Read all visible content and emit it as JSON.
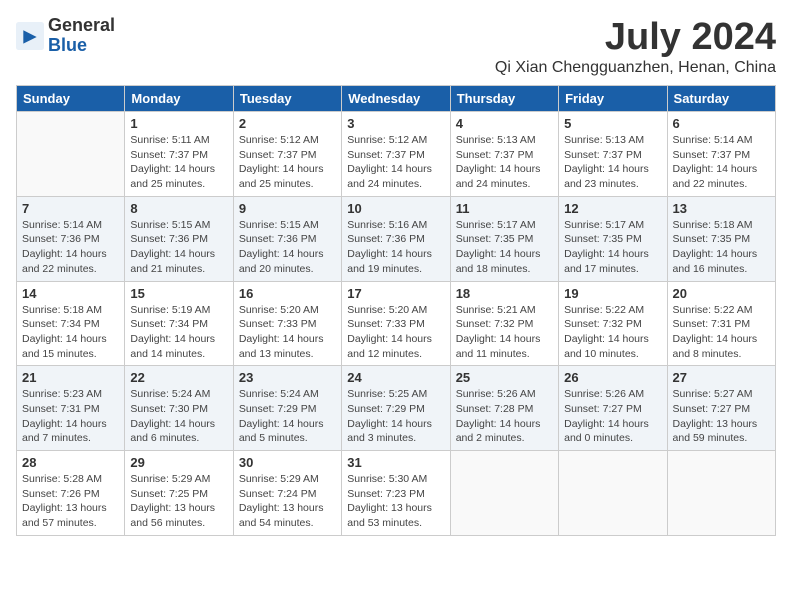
{
  "logo": {
    "general": "General",
    "blue": "Blue"
  },
  "title": "July 2024",
  "subtitle": "Qi Xian Chengguanzhen, Henan, China",
  "days_header": [
    "Sunday",
    "Monday",
    "Tuesday",
    "Wednesday",
    "Thursday",
    "Friday",
    "Saturday"
  ],
  "weeks": [
    [
      {
        "num": "",
        "lines": []
      },
      {
        "num": "1",
        "lines": [
          "Sunrise: 5:11 AM",
          "Sunset: 7:37 PM",
          "Daylight: 14 hours",
          "and 25 minutes."
        ]
      },
      {
        "num": "2",
        "lines": [
          "Sunrise: 5:12 AM",
          "Sunset: 7:37 PM",
          "Daylight: 14 hours",
          "and 25 minutes."
        ]
      },
      {
        "num": "3",
        "lines": [
          "Sunrise: 5:12 AM",
          "Sunset: 7:37 PM",
          "Daylight: 14 hours",
          "and 24 minutes."
        ]
      },
      {
        "num": "4",
        "lines": [
          "Sunrise: 5:13 AM",
          "Sunset: 7:37 PM",
          "Daylight: 14 hours",
          "and 24 minutes."
        ]
      },
      {
        "num": "5",
        "lines": [
          "Sunrise: 5:13 AM",
          "Sunset: 7:37 PM",
          "Daylight: 14 hours",
          "and 23 minutes."
        ]
      },
      {
        "num": "6",
        "lines": [
          "Sunrise: 5:14 AM",
          "Sunset: 7:37 PM",
          "Daylight: 14 hours",
          "and 22 minutes."
        ]
      }
    ],
    [
      {
        "num": "7",
        "lines": [
          "Sunrise: 5:14 AM",
          "Sunset: 7:36 PM",
          "Daylight: 14 hours",
          "and 22 minutes."
        ]
      },
      {
        "num": "8",
        "lines": [
          "Sunrise: 5:15 AM",
          "Sunset: 7:36 PM",
          "Daylight: 14 hours",
          "and 21 minutes."
        ]
      },
      {
        "num": "9",
        "lines": [
          "Sunrise: 5:15 AM",
          "Sunset: 7:36 PM",
          "Daylight: 14 hours",
          "and 20 minutes."
        ]
      },
      {
        "num": "10",
        "lines": [
          "Sunrise: 5:16 AM",
          "Sunset: 7:36 PM",
          "Daylight: 14 hours",
          "and 19 minutes."
        ]
      },
      {
        "num": "11",
        "lines": [
          "Sunrise: 5:17 AM",
          "Sunset: 7:35 PM",
          "Daylight: 14 hours",
          "and 18 minutes."
        ]
      },
      {
        "num": "12",
        "lines": [
          "Sunrise: 5:17 AM",
          "Sunset: 7:35 PM",
          "Daylight: 14 hours",
          "and 17 minutes."
        ]
      },
      {
        "num": "13",
        "lines": [
          "Sunrise: 5:18 AM",
          "Sunset: 7:35 PM",
          "Daylight: 14 hours",
          "and 16 minutes."
        ]
      }
    ],
    [
      {
        "num": "14",
        "lines": [
          "Sunrise: 5:18 AM",
          "Sunset: 7:34 PM",
          "Daylight: 14 hours",
          "and 15 minutes."
        ]
      },
      {
        "num": "15",
        "lines": [
          "Sunrise: 5:19 AM",
          "Sunset: 7:34 PM",
          "Daylight: 14 hours",
          "and 14 minutes."
        ]
      },
      {
        "num": "16",
        "lines": [
          "Sunrise: 5:20 AM",
          "Sunset: 7:33 PM",
          "Daylight: 14 hours",
          "and 13 minutes."
        ]
      },
      {
        "num": "17",
        "lines": [
          "Sunrise: 5:20 AM",
          "Sunset: 7:33 PM",
          "Daylight: 14 hours",
          "and 12 minutes."
        ]
      },
      {
        "num": "18",
        "lines": [
          "Sunrise: 5:21 AM",
          "Sunset: 7:32 PM",
          "Daylight: 14 hours",
          "and 11 minutes."
        ]
      },
      {
        "num": "19",
        "lines": [
          "Sunrise: 5:22 AM",
          "Sunset: 7:32 PM",
          "Daylight: 14 hours",
          "and 10 minutes."
        ]
      },
      {
        "num": "20",
        "lines": [
          "Sunrise: 5:22 AM",
          "Sunset: 7:31 PM",
          "Daylight: 14 hours",
          "and 8 minutes."
        ]
      }
    ],
    [
      {
        "num": "21",
        "lines": [
          "Sunrise: 5:23 AM",
          "Sunset: 7:31 PM",
          "Daylight: 14 hours",
          "and 7 minutes."
        ]
      },
      {
        "num": "22",
        "lines": [
          "Sunrise: 5:24 AM",
          "Sunset: 7:30 PM",
          "Daylight: 14 hours",
          "and 6 minutes."
        ]
      },
      {
        "num": "23",
        "lines": [
          "Sunrise: 5:24 AM",
          "Sunset: 7:29 PM",
          "Daylight: 14 hours",
          "and 5 minutes."
        ]
      },
      {
        "num": "24",
        "lines": [
          "Sunrise: 5:25 AM",
          "Sunset: 7:29 PM",
          "Daylight: 14 hours",
          "and 3 minutes."
        ]
      },
      {
        "num": "25",
        "lines": [
          "Sunrise: 5:26 AM",
          "Sunset: 7:28 PM",
          "Daylight: 14 hours",
          "and 2 minutes."
        ]
      },
      {
        "num": "26",
        "lines": [
          "Sunrise: 5:26 AM",
          "Sunset: 7:27 PM",
          "Daylight: 14 hours",
          "and 0 minutes."
        ]
      },
      {
        "num": "27",
        "lines": [
          "Sunrise: 5:27 AM",
          "Sunset: 7:27 PM",
          "Daylight: 13 hours",
          "and 59 minutes."
        ]
      }
    ],
    [
      {
        "num": "28",
        "lines": [
          "Sunrise: 5:28 AM",
          "Sunset: 7:26 PM",
          "Daylight: 13 hours",
          "and 57 minutes."
        ]
      },
      {
        "num": "29",
        "lines": [
          "Sunrise: 5:29 AM",
          "Sunset: 7:25 PM",
          "Daylight: 13 hours",
          "and 56 minutes."
        ]
      },
      {
        "num": "30",
        "lines": [
          "Sunrise: 5:29 AM",
          "Sunset: 7:24 PM",
          "Daylight: 13 hours",
          "and 54 minutes."
        ]
      },
      {
        "num": "31",
        "lines": [
          "Sunrise: 5:30 AM",
          "Sunset: 7:23 PM",
          "Daylight: 13 hours",
          "and 53 minutes."
        ]
      },
      {
        "num": "",
        "lines": []
      },
      {
        "num": "",
        "lines": []
      },
      {
        "num": "",
        "lines": []
      }
    ]
  ]
}
